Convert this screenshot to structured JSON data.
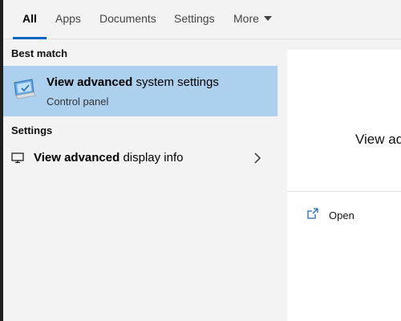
{
  "tabs": [
    {
      "label": "All",
      "active": true
    },
    {
      "label": "Apps",
      "active": false
    },
    {
      "label": "Documents",
      "active": false
    },
    {
      "label": "Settings",
      "active": false
    },
    {
      "label": "More",
      "active": false
    }
  ],
  "sections": {
    "best_match_label": "Best match",
    "settings_label": "Settings"
  },
  "best_match": {
    "title_bold": "View advanced",
    "title_rest": " system settings",
    "subtitle": "Control panel",
    "icon": "control-panel-monitor-icon",
    "highlight_color": "#acd0ee"
  },
  "settings_results": [
    {
      "title_bold": "View advanced",
      "title_rest": " display info",
      "icon": "monitor-icon"
    }
  ],
  "preview": {
    "title": "View ad",
    "actions": [
      {
        "label": "Open",
        "icon": "open-window-icon"
      }
    ]
  },
  "colors": {
    "accent": "#0067c0",
    "panel_bg": "#f3f3f3",
    "preview_bg": "#ffffff"
  }
}
